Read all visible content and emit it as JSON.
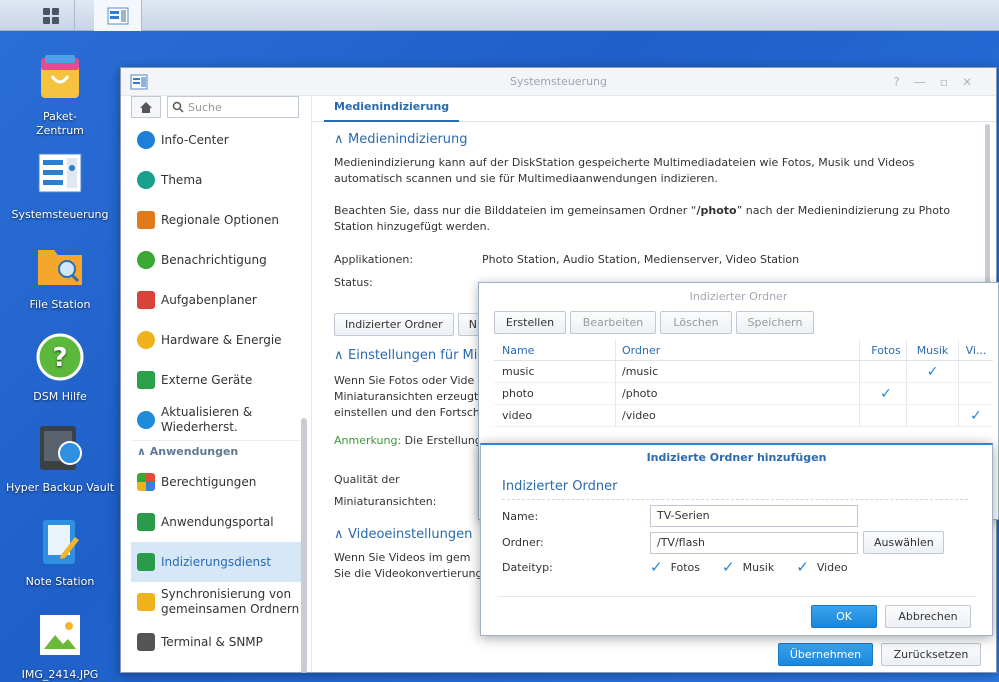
{
  "desktop": {
    "icons": [
      {
        "label": "Paket-\nZentrum",
        "icon": "package-center-icon"
      },
      {
        "label": "Systemsteuerung",
        "icon": "control-panel-icon"
      },
      {
        "label": "File Station",
        "icon": "file-station-icon"
      },
      {
        "label": "DSM Hilfe",
        "icon": "help-icon"
      },
      {
        "label": "Hyper Backup Vault",
        "icon": "hyper-backup-vault-icon"
      },
      {
        "label": "Note Station",
        "icon": "note-station-icon"
      },
      {
        "label": "IMG_2414.JPG",
        "icon": "image-file-icon"
      }
    ]
  },
  "window": {
    "title": "Systemsteuerung",
    "search_placeholder": "Suche",
    "nav": [
      {
        "label": "Info-Center",
        "color": "#1e7fd8"
      },
      {
        "label": "Thema",
        "color": "#1aa08f"
      },
      {
        "label": "Regionale Optionen",
        "color": "#e07a1a"
      },
      {
        "label": "Benachrichtigung",
        "color": "#3aa832"
      },
      {
        "label": "Aufgabenplaner",
        "color": "#d9443a"
      },
      {
        "label": "Hardware & Energie",
        "color": "#f0b21c"
      },
      {
        "label": "Externe Geräte",
        "color": "#2aa04a"
      },
      {
        "label": "Aktualisieren &\nWiederherst.",
        "color": "#1e8ad8"
      }
    ],
    "nav_section": "Anwendungen",
    "nav2": [
      {
        "label": "Berechtigungen",
        "color": "#e24a3a"
      },
      {
        "label": "Anwendungsportal",
        "color": "#2a9b4a"
      },
      {
        "label": "Indizierungsdienst",
        "color": "#2a9b4a"
      },
      {
        "label": "Synchronisierung von\ngemeinsamen Ordnern",
        "color": "#f0b21c"
      },
      {
        "label": "Terminal & SNMP",
        "color": "#555"
      }
    ],
    "tab": "Medienindizierung",
    "section1": "Medienindizierung",
    "para1": "Medienindizierung kann auf der DiskStation gespeicherte Multimediadateien wie Fotos, Musik und Videos automatisch scannen und sie für Multimediaanwendungen indizieren.",
    "para2_a": "Beachten Sie, dass nur die Bilddateien im gemeinsamen Ordner “",
    "para2_b": "/photo",
    "para2_c": "” nach der Medienindizierung zu Photo Station hinzugefügt werden.",
    "apps_label": "Applikationen:",
    "apps_value": "Photo Station, Audio Station, Medienserver, Video Station",
    "status_label": "Status:",
    "btn_indexed": "Indizierter Ordner",
    "btn_n": "N",
    "section2": "Einstellungen für Min",
    "para3_lines": [
      "Wenn Sie Fotos oder Vide",
      "Miniaturansichten erzeugt,",
      "einstellen und den Fortsch"
    ],
    "note_label": "Anmerkung:",
    "note_text": " Die Erstellung",
    "quality_label_1": "Qualität der",
    "quality_label_2": "Miniaturansichten:",
    "section3": "Videoeinstellungen",
    "para4_lines": [
      "Wenn Sie Videos im gem",
      "Sie die Videokonvertierung"
    ],
    "apply": "Übernehmen",
    "reset": "Zurücksetzen"
  },
  "indexed_dialog": {
    "title": "Indizierter Ordner",
    "toolbar": [
      "Erstellen",
      "Bearbeiten",
      "Löschen",
      "Speichern"
    ],
    "columns": [
      "Name",
      "Ordner",
      "Fotos",
      "Musik",
      "Vi..."
    ],
    "rows": [
      {
        "name": "music",
        "folder": "/music",
        "fotos": false,
        "musik": true,
        "video": false
      },
      {
        "name": "photo",
        "folder": "/photo",
        "fotos": true,
        "musik": false,
        "video": false
      },
      {
        "name": "video",
        "folder": "/video",
        "fotos": false,
        "musik": false,
        "video": true
      }
    ]
  },
  "add_dialog": {
    "title": "Indizierte Ordner hinzufügen",
    "heading": "Indizierter Ordner",
    "name_label": "Name:",
    "name_value": "TV-Serien",
    "folder_label": "Ordner:",
    "folder_value": "/TV/flash",
    "browse": "Auswählen",
    "type_label": "Dateityp:",
    "types": [
      {
        "label": "Fotos",
        "checked": true
      },
      {
        "label": "Musik",
        "checked": true
      },
      {
        "label": "Video",
        "checked": true
      }
    ],
    "ok": "OK",
    "cancel": "Abbrechen"
  }
}
